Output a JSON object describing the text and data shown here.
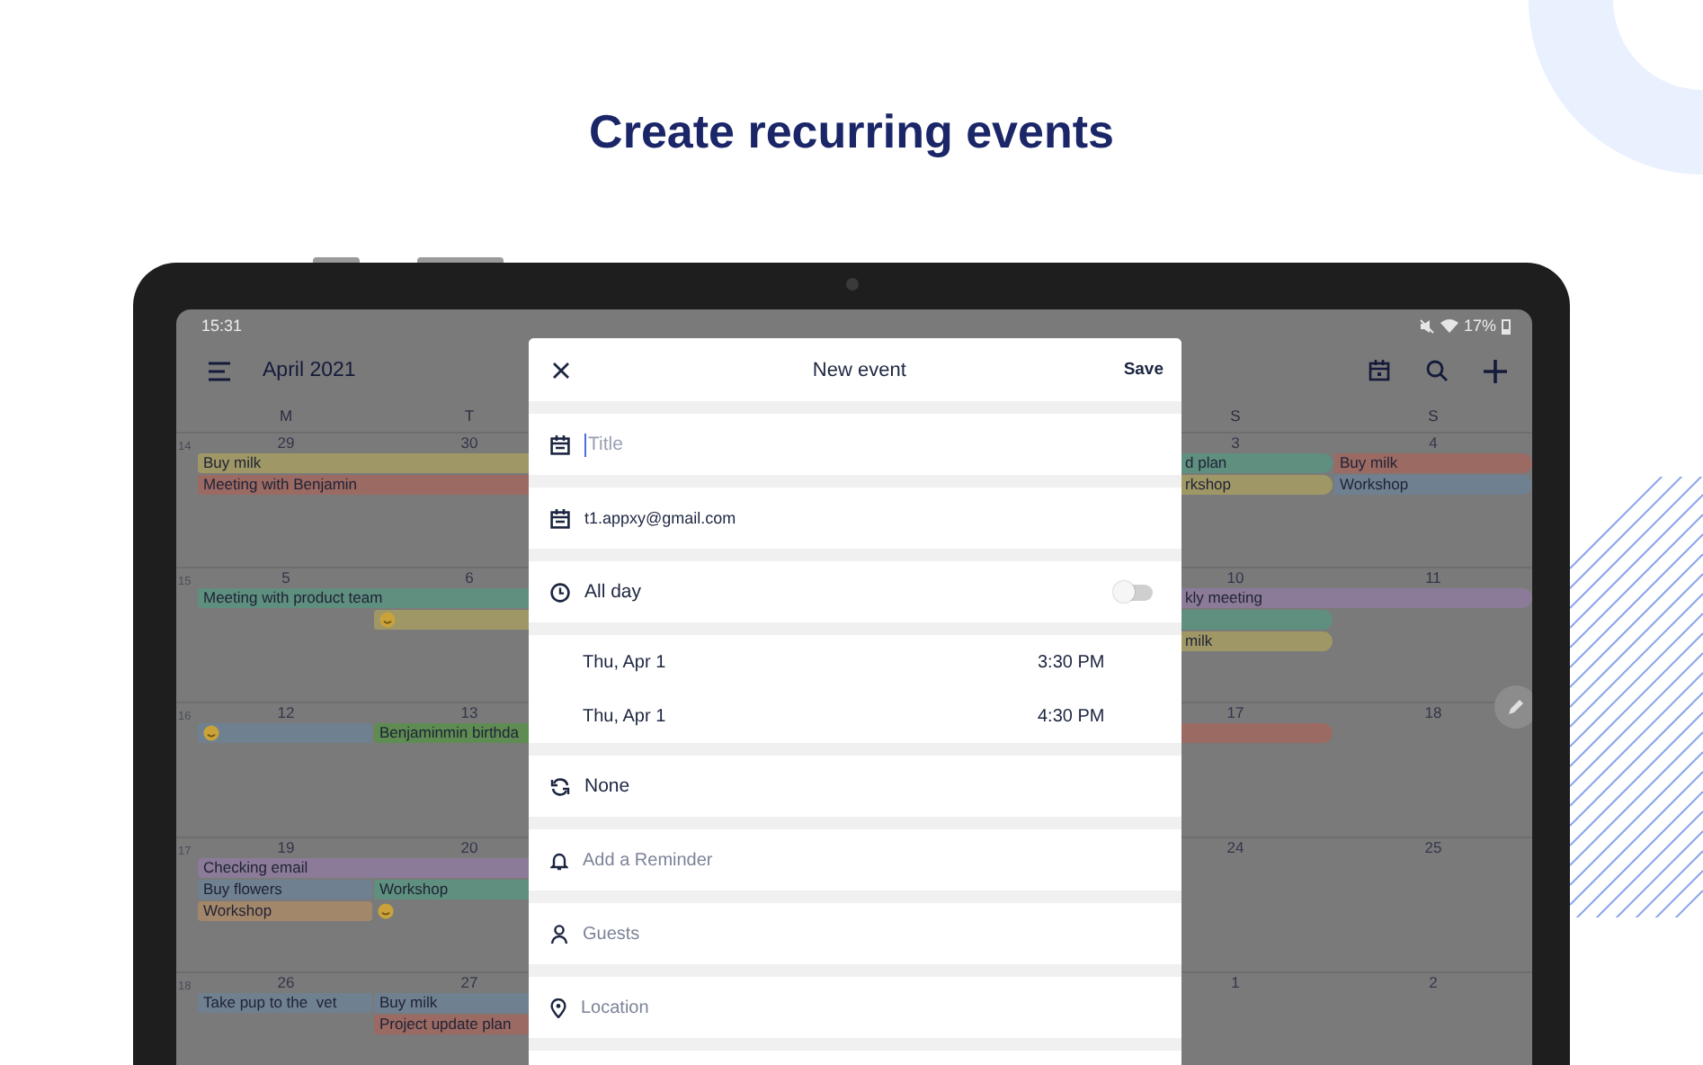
{
  "heading": "Create recurring events",
  "status_bar": {
    "time": "15:31",
    "battery": "17%"
  },
  "app_bar": {
    "title": "April 2021"
  },
  "weekdays": [
    "M",
    "T",
    "S",
    "S"
  ],
  "weeks": [
    {
      "number": "14",
      "days": [
        "29",
        "30",
        "3",
        "4"
      ],
      "monday": [
        {
          "kind": "bar",
          "text": "Buy milk",
          "color": "#9f9866",
          "continues_left": false,
          "continues_right": true
        },
        {
          "kind": "bar",
          "text": "Meeting with Benjamin",
          "color": "#9b6a63",
          "continues_left": false,
          "continues_right": true
        }
      ],
      "saturday": [
        {
          "kind": "bar",
          "text": "d plan",
          "color": "#5f8f7e",
          "continues_left": true,
          "continues_right": false
        },
        {
          "kind": "bar",
          "text": "rkshop",
          "color": "#9f9866",
          "continues_left": true,
          "continues_right": false
        }
      ],
      "sunday": [
        {
          "kind": "bar",
          "text": "Buy milk",
          "color": "#9b6a63",
          "continues_left": false,
          "continues_right": false
        },
        {
          "kind": "bar",
          "text": "Workshop",
          "color": "#6f8090",
          "continues_left": false,
          "continues_right": false
        }
      ]
    },
    {
      "number": "15",
      "days": [
        "5",
        "6",
        "10",
        "11"
      ],
      "monday": [
        {
          "kind": "bar",
          "text": "Meeting with product team",
          "color": "#5f8f7e",
          "continues_left": false,
          "continues_right": true
        }
      ],
      "tuesday": [
        {
          "kind": "emoji",
          "color": "#9f9866",
          "continues_left": false,
          "continues_right": true
        }
      ],
      "saturday": [
        {
          "kind": "bar",
          "text": "kly meeting",
          "color": "#8b7b98",
          "continues_left": true,
          "continues_right": true
        },
        {
          "kind": "blank",
          "color": "#5f8f7e",
          "continues_left": true,
          "continues_right": false
        },
        {
          "kind": "bar",
          "text": "milk",
          "color": "#9f9866",
          "continues_left": true,
          "continues_right": false
        }
      ]
    },
    {
      "number": "16",
      "days": [
        "12",
        "13",
        "17",
        "18"
      ],
      "monday": [
        {
          "kind": "emoji",
          "color": "#6f8090",
          "continues_left": false,
          "continues_right": false
        }
      ],
      "tuesday": [
        {
          "kind": "bar",
          "text": "Benjaminmin birthda",
          "color": "#5e8c52",
          "continues_left": false,
          "continues_right": true
        }
      ],
      "saturday": [
        {
          "kind": "blank",
          "color": "#9b6a63",
          "continues_left": true,
          "continues_right": false
        }
      ]
    },
    {
      "number": "17",
      "days": [
        "19",
        "20",
        "24",
        "25"
      ],
      "monday": [
        {
          "kind": "bar",
          "text": "Checking email",
          "color": "#8b7b98",
          "continues_left": false,
          "continues_right": true
        },
        {
          "kind": "bar",
          "text": "Buy flowers",
          "color": "#6f8090",
          "continues_left": false,
          "continues_right": false
        },
        {
          "kind": "bar",
          "text": "Workshop",
          "color": "#a3876a",
          "continues_left": false,
          "continues_right": false
        }
      ],
      "tuesday": [
        {
          "kind": "bar",
          "text": "Workshop",
          "color": "#5f8f7e",
          "continues_left": false,
          "continues_right": true
        },
        {
          "kind": "emoji"
        }
      ]
    },
    {
      "number": "18",
      "days": [
        "26",
        "27",
        "1",
        "2"
      ],
      "monday": [
        {
          "kind": "bar",
          "text": "Take pup to the  vet",
          "color": "#6f8090",
          "continues_left": false,
          "continues_right": false
        }
      ],
      "tuesday": [
        {
          "kind": "bar",
          "text": "Buy milk",
          "color": "#6f8090",
          "continues_left": false,
          "continues_right": true
        },
        {
          "kind": "bar",
          "text": "Project update plan",
          "color": "#9b6a63",
          "continues_left": false,
          "continues_right": true
        }
      ]
    }
  ],
  "dialog": {
    "title": "New event",
    "save": "Save",
    "sections": [
      {
        "kind": "title",
        "placeholder": "Title"
      },
      {
        "kind": "account",
        "value": "t1.appxy@gmail.com"
      },
      {
        "kind": "all_day",
        "label": "All day",
        "on": false
      },
      {
        "kind": "times",
        "rows": [
          {
            "date": "Thu, Apr 1",
            "time": "3:30 PM"
          },
          {
            "date": "Thu, Apr 1",
            "time": "4:30 PM"
          }
        ]
      },
      {
        "kind": "repeat",
        "value": "None"
      },
      {
        "kind": "reminder",
        "placeholder": "Add a Reminder"
      },
      {
        "kind": "guests",
        "placeholder": "Guests"
      },
      {
        "kind": "location",
        "placeholder": "Location"
      },
      {
        "kind": "blank"
      }
    ]
  }
}
